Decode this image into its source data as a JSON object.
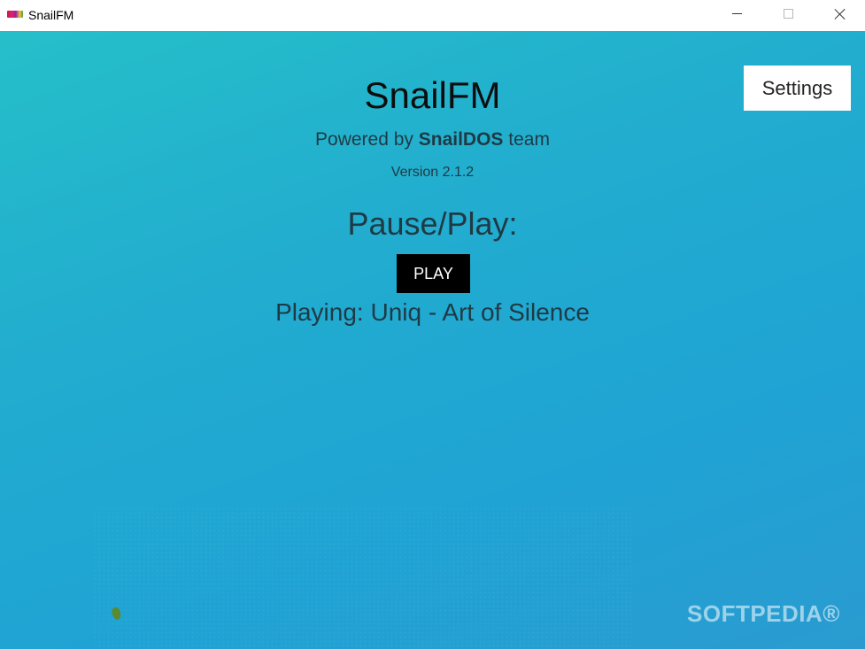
{
  "window": {
    "title": "SnailFM",
    "controls": {
      "minimize": "minimize-icon",
      "maximize": "maximize-icon",
      "close": "close-icon"
    }
  },
  "settings": {
    "label": "Settings"
  },
  "header": {
    "title": "SnailFM",
    "powered_prefix": "Powered by ",
    "powered_team_name": "SnailDOS",
    "powered_suffix": " team",
    "version": "Version 2.1.2"
  },
  "player": {
    "heading": "Pause/Play:",
    "play_label": "PLAY",
    "now_playing": "Playing: Uniq - Art of Silence"
  },
  "watermark": {
    "text": "SOFTPEDIA®"
  },
  "colors": {
    "background_start": "#25bfc9",
    "background_end": "#2a9bd0",
    "play_button_bg": "#000000",
    "settings_button_bg": "#ffffff"
  }
}
